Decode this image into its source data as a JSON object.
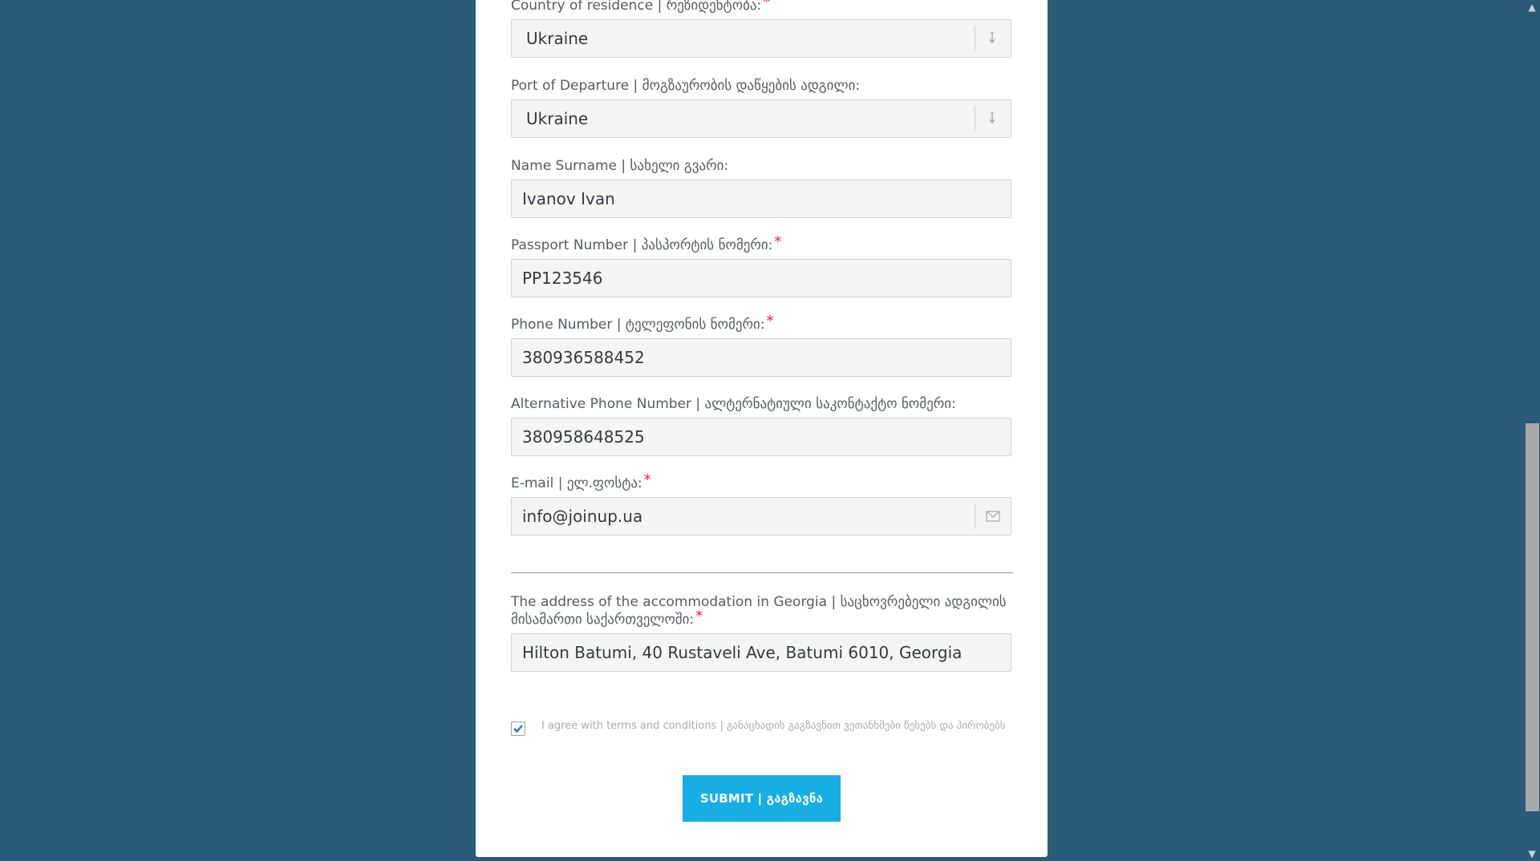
{
  "form": {
    "country": {
      "label": "Country of residence | რეზიდენტობა:",
      "required_mark": "*",
      "value": "Ukraine",
      "icon": "sort-arrow-icon"
    },
    "port": {
      "label": "Port of Departure | მოგზაურობის დაწყების ადგილი:",
      "value": "Ukraine",
      "icon": "sort-arrow-icon"
    },
    "name": {
      "label": "Name Surname | სახელი გვარი:",
      "value": "Ivanov Ivan"
    },
    "passport": {
      "label": "Passport Number | პასპორტის ნომერი:",
      "required_mark": "*",
      "value": "PP123546"
    },
    "phone": {
      "label": "Phone Number | ტელეფონის ნომერი:",
      "required_mark": "*",
      "value": "380936588452"
    },
    "alt_phone": {
      "label": "Alternative Phone Number | ალტერნატიული საკონტაქტო ნომერი:",
      "value": "380958648525"
    },
    "email": {
      "label": "E-mail | ელ.ფოსტა:",
      "required_mark": "*",
      "value": "info@joinup.ua",
      "icon": "envelope-icon"
    },
    "address": {
      "label": "The address of the accommodation in Georgia | საცხოვრებელი ადგილის მისამართი საქართველოში:",
      "required_mark": "*",
      "value": "Hilton Batumi,  40 Rustaveli Ave, Batumi 6010, Georgia"
    },
    "agree": {
      "checked": true,
      "text": "I agree with terms and conditions | განაცხადის გაგზავნით ვეთანხმები წესებს და პირობებს"
    },
    "submit_label": "SUBMIT | გაგზავნა"
  },
  "colors": {
    "background": "#2b5b78",
    "accent": "#17aee4",
    "required": "#e1243b"
  }
}
